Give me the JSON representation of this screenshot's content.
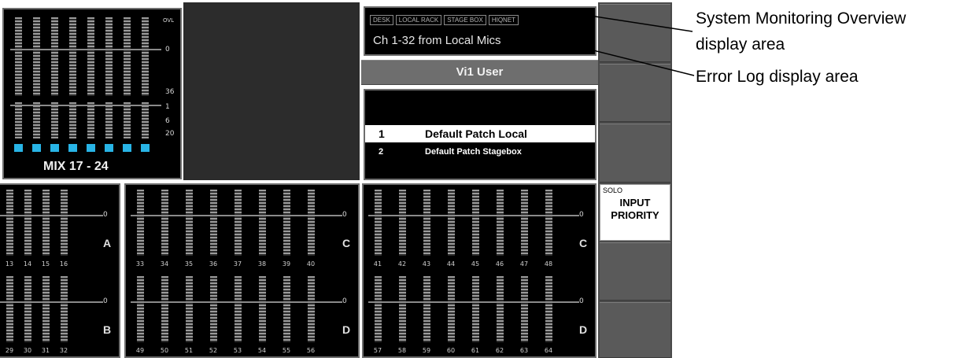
{
  "mix_section": {
    "title": "MIX 17 - 24",
    "scale_top": [
      "OVL",
      "0",
      "36"
    ],
    "scale_bottom": [
      "1",
      "6",
      "20"
    ]
  },
  "bank_left": {
    "bank_upper_letter": "A",
    "bank_lower_letter": "B",
    "zero_label": "0",
    "upper_channels": [
      "13",
      "14",
      "15",
      "16"
    ],
    "lower_channels": [
      "29",
      "30",
      "31",
      "32"
    ]
  },
  "bank_middle": {
    "bank_upper_letter": "C",
    "bank_lower_letter": "D",
    "zero_label": "0",
    "upper_channels": [
      "33",
      "34",
      "35",
      "36",
      "37",
      "38",
      "39",
      "40"
    ],
    "lower_channels": [
      "49",
      "50",
      "51",
      "52",
      "53",
      "54",
      "55",
      "56"
    ]
  },
  "bank_right": {
    "bank_upper_letter": "C",
    "bank_lower_letter": "D",
    "zero_label": "0",
    "upper_channels": [
      "41",
      "42",
      "43",
      "44",
      "45",
      "46",
      "47",
      "48"
    ],
    "lower_channels": [
      "57",
      "58",
      "59",
      "60",
      "61",
      "62",
      "63",
      "64"
    ]
  },
  "monitoring": {
    "tabs": [
      "DESK",
      "LOCAL RACK",
      "STAGE BOX",
      "HIQNET"
    ],
    "message": "Ch 1-32 from Local Mics"
  },
  "user_bar": {
    "label": "Vi1 User"
  },
  "patch_list": {
    "items": [
      {
        "number": "1",
        "name": "Default Patch Local"
      },
      {
        "number": "2",
        "name": "Default Patch Stagebox"
      }
    ]
  },
  "side_buttons": {
    "solo_small": "SOLO",
    "solo_line1": "INPUT",
    "solo_line2": "PRIORITY"
  },
  "annotations": {
    "monitor_line1": "System Monitoring Overview",
    "monitor_line2": "display area",
    "error_log": "Error Log display area"
  },
  "colors": {
    "meter_cyan": "#28b4e6",
    "panel_bg": "#000000",
    "frame_grey": "#6e6e6e"
  }
}
